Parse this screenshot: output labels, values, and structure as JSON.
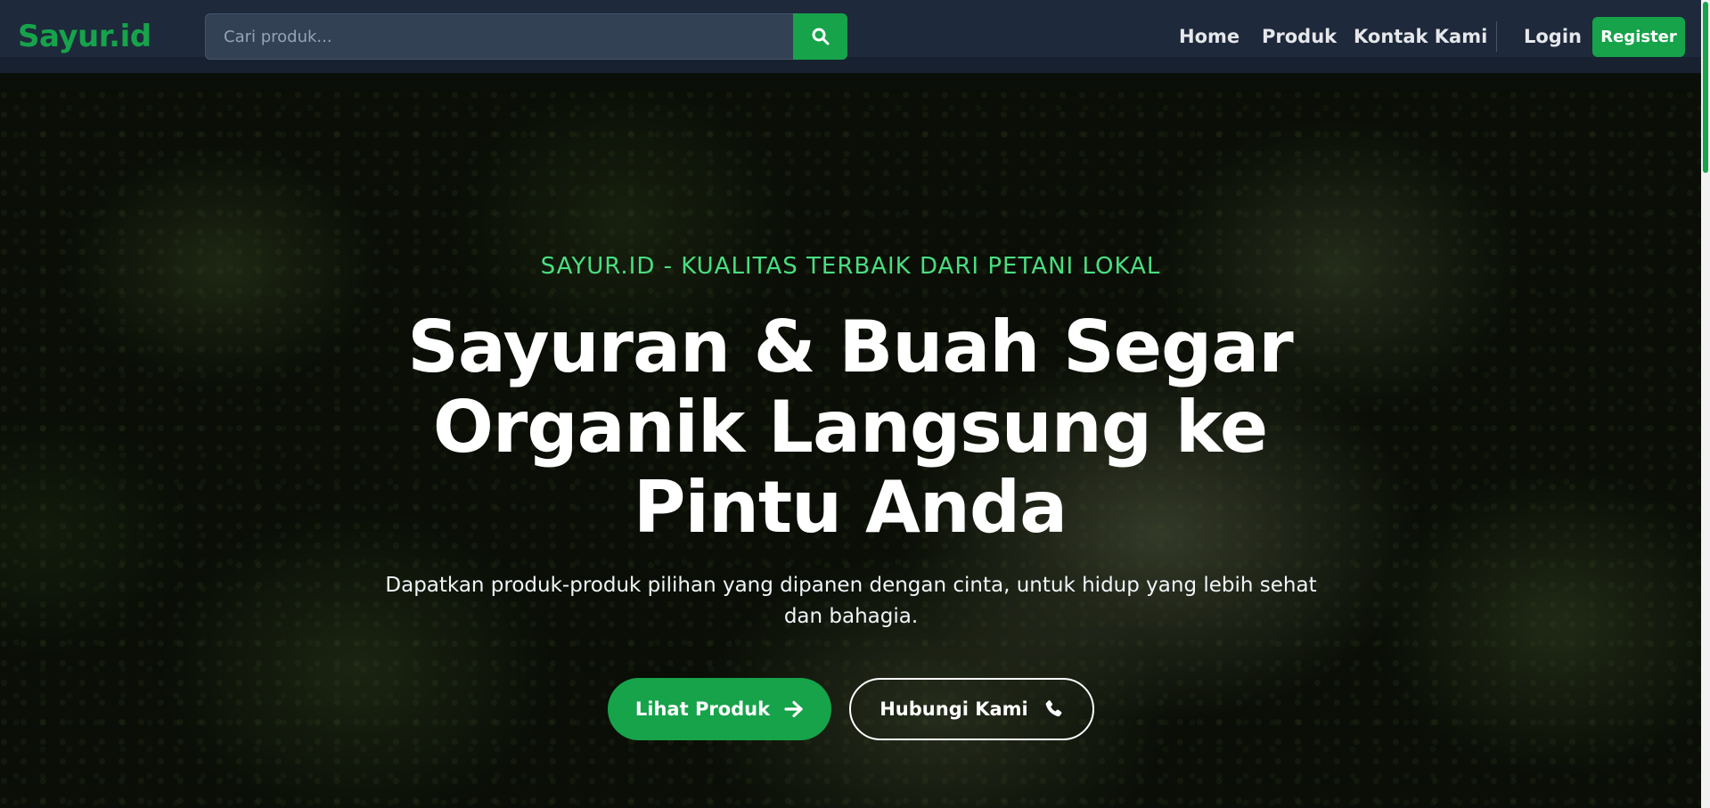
{
  "navbar": {
    "brand": "Sayur.id",
    "search": {
      "placeholder": "Cari produk...",
      "value": "",
      "button_icon": "search-icon"
    },
    "links": [
      {
        "label": "Home"
      },
      {
        "label": "Produk"
      },
      {
        "label": "Kontak Kami"
      }
    ],
    "login_label": "Login",
    "register_label": "Register"
  },
  "hero": {
    "eyebrow": "SAYUR.ID - KUALITAS TERBAIK DARI PETANI LOKAL",
    "title": "Sayuran & Buah Segar Organik Langsung ke Pintu Anda",
    "description": "Dapatkan produk-produk pilihan yang dipanen dengan cinta, untuk hidup yang lebih sehat dan bahagia.",
    "cta_primary": {
      "label": "Lihat Produk",
      "icon": "arrow-right-icon"
    },
    "cta_secondary": {
      "label": "Hubungi Kami",
      "icon": "phone-icon"
    }
  },
  "colors": {
    "accent": "#16a34a",
    "eyebrow": "#4ade80",
    "navbar_bg": "#1e293b"
  }
}
